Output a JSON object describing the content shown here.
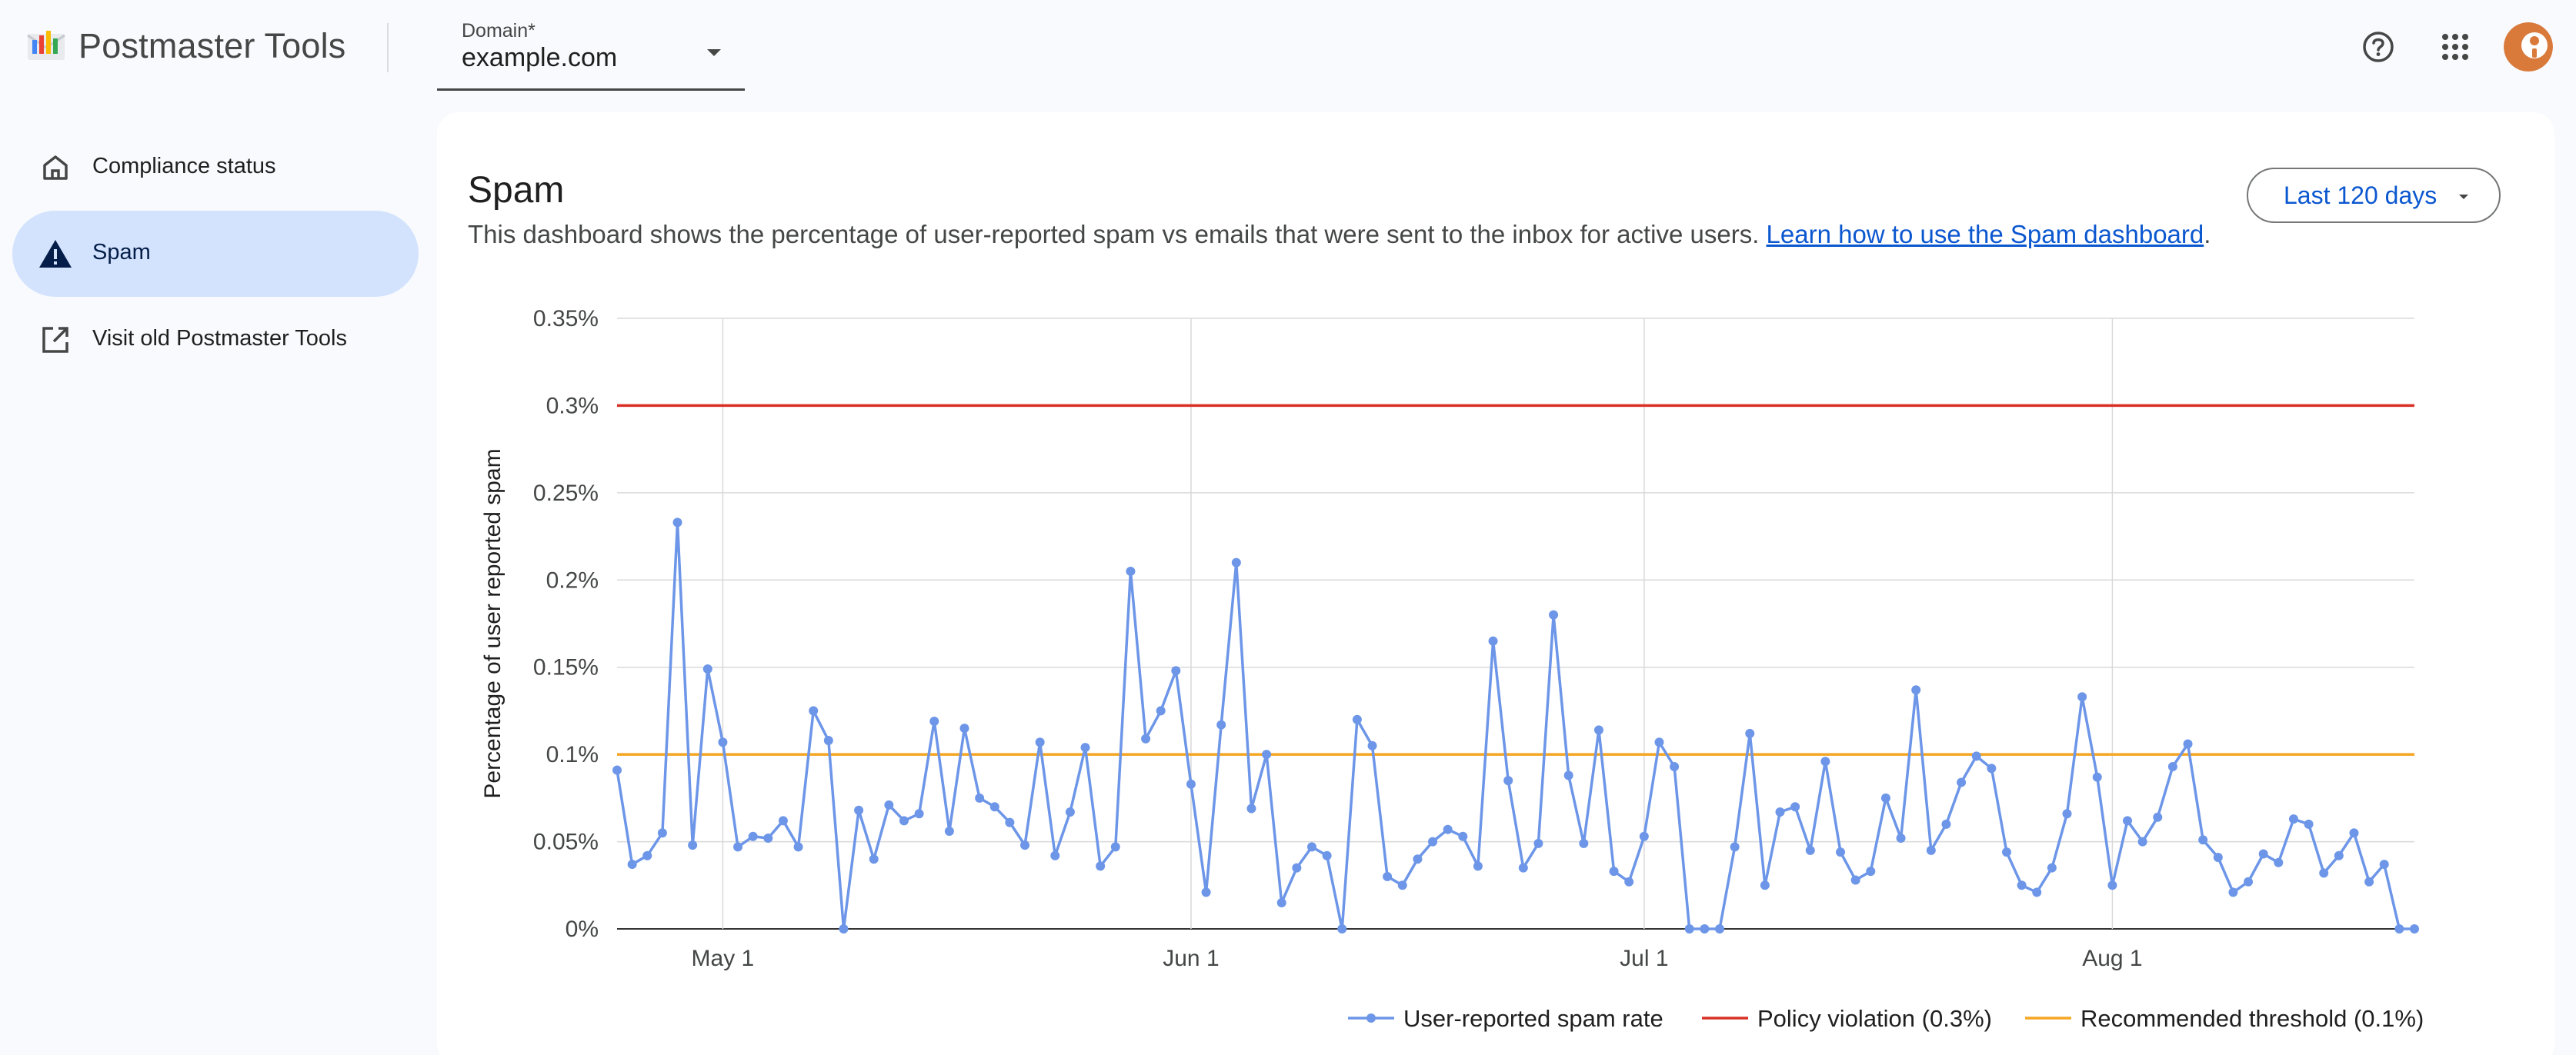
{
  "header": {
    "app_title": "Postmaster Tools",
    "domain_label": "Domain*",
    "domain_value": "example.com",
    "help_icon": "help-circle-icon",
    "apps_icon": "apps-grid-icon"
  },
  "sidebar": {
    "items": [
      {
        "label": "Compliance status",
        "icon": "home-icon",
        "active": false
      },
      {
        "label": "Spam",
        "icon": "warning-icon",
        "active": true
      },
      {
        "label": "Visit old Postmaster Tools",
        "icon": "open-in-new-icon",
        "active": false
      }
    ]
  },
  "main": {
    "title": "Spam",
    "description": "This dashboard shows the percentage of user-reported spam vs emails that were sent to the inbox for active users.",
    "learn_link": "Learn how to use the Spam dashboard",
    "description_end": ".",
    "range_button": "Last 120 days"
  },
  "colors": {
    "series": "#6d96e8",
    "policy": "#d93025",
    "threshold": "#f5a623",
    "grid": "#d9d9d9",
    "accent": "#0b57d0",
    "active_nav": "#d3e3fd"
  },
  "chart_data": {
    "type": "line",
    "ylabel": "Percentage of user reported spam",
    "ylim": [
      0,
      0.35
    ],
    "y_ticks": [
      "0%",
      "0.05%",
      "0.1%",
      "0.15%",
      "0.2%",
      "0.25%",
      "0.3%",
      "0.35%"
    ],
    "x_ticks": [
      "May 1",
      "Jun 1",
      "Jul 1",
      "Aug 1"
    ],
    "legend_position": "bottom-right",
    "grid": true,
    "series": [
      {
        "name": "User-reported spam rate",
        "type": "line",
        "values": [
          0.091,
          0.037,
          0.042,
          0.055,
          0.233,
          0.048,
          0.149,
          0.107,
          0.047,
          0.053,
          0.052,
          0.062,
          0.047,
          0.125,
          0.108,
          0.0,
          0.068,
          0.04,
          0.071,
          0.062,
          0.066,
          0.119,
          0.056,
          0.115,
          0.075,
          0.07,
          0.061,
          0.048,
          0.107,
          0.042,
          0.067,
          0.104,
          0.036,
          0.047,
          0.205,
          0.109,
          0.125,
          0.148,
          0.083,
          0.021,
          0.117,
          0.21,
          0.069,
          0.1,
          0.015,
          0.035,
          0.047,
          0.042,
          0.0,
          0.12,
          0.105,
          0.03,
          0.025,
          0.04,
          0.05,
          0.057,
          0.053,
          0.036,
          0.165,
          0.085,
          0.035,
          0.049,
          0.18,
          0.088,
          0.049,
          0.114,
          0.033,
          0.027,
          0.053,
          0.107,
          0.093,
          0.0,
          0.0,
          0.0,
          0.047,
          0.112,
          0.025,
          0.067,
          0.07,
          0.045,
          0.096,
          0.044,
          0.028,
          0.033,
          0.075,
          0.052,
          0.137,
          0.045,
          0.06,
          0.084,
          0.099,
          0.092,
          0.044,
          0.025,
          0.021,
          0.035,
          0.066,
          0.133,
          0.087,
          0.025,
          0.062,
          0.05,
          0.064,
          0.093,
          0.106,
          0.051,
          0.041,
          0.021,
          0.027,
          0.043,
          0.038,
          0.063,
          0.06,
          0.032,
          0.042,
          0.055,
          0.027,
          0.037,
          0.0,
          0.0
        ]
      },
      {
        "name": "Policy violation (0.3%)",
        "type": "hline",
        "value": 0.3
      },
      {
        "name": "Recommended threshold (0.1%)",
        "type": "hline",
        "value": 0.1
      }
    ]
  }
}
